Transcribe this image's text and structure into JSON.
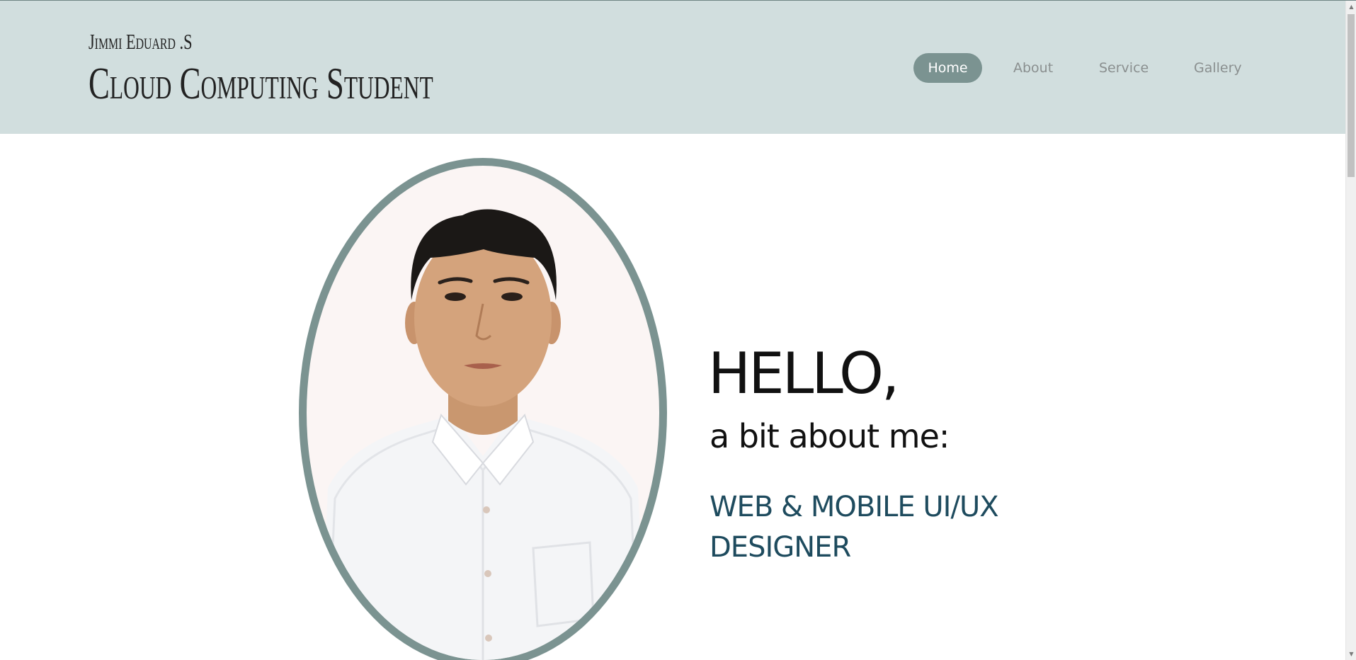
{
  "header": {
    "subtitle": "Jimmi Eduard .S",
    "title": "Cloud Computing Student"
  },
  "nav": {
    "items": [
      {
        "label": "Home",
        "active": true
      },
      {
        "label": "About",
        "active": false
      },
      {
        "label": "Service",
        "active": false
      },
      {
        "label": "Gallery",
        "active": false
      }
    ]
  },
  "hero": {
    "greeting": "HELLO,",
    "intro": "a bit about me:",
    "role": "WEB & MOBILE UI/UX DESIGNER",
    "portrait_icon": "profile-photo"
  },
  "scrollbar": {
    "up_icon": "▲",
    "down_icon": "▼"
  },
  "colors": {
    "header_bg": "#d1dede",
    "accent": "#7b9391",
    "role_text": "#1e4b5e",
    "nav_text": "#8a8f8f"
  }
}
